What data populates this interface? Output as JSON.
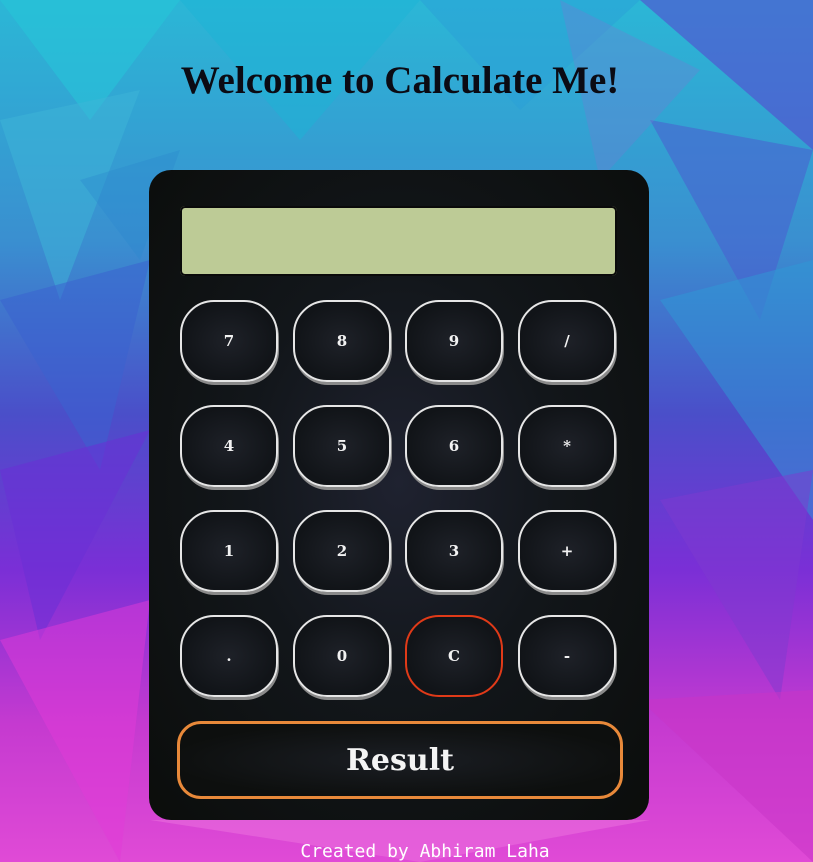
{
  "page": {
    "title": "Welcome to Calculate Me!",
    "footer": "Created by Abhiram Laha"
  },
  "calculator": {
    "display_value": "",
    "keys": [
      "7",
      "8",
      "9",
      "/",
      "4",
      "5",
      "6",
      "*",
      "1",
      "2",
      "3",
      "+",
      ".",
      "0",
      "C",
      "-"
    ],
    "result_label": "Result"
  },
  "colors": {
    "display": "#bdcb96",
    "body": "#0e1012",
    "key_border": "#e6e6e6",
    "clear_border": "#e03a18",
    "result_border": "#e8893a"
  }
}
